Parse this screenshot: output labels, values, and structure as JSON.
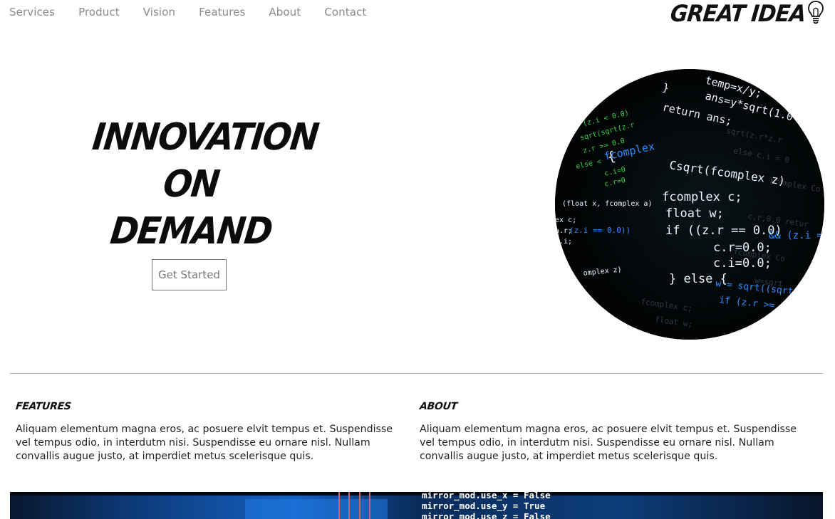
{
  "nav": {
    "items": [
      "Services",
      "Product",
      "Vision",
      "Features",
      "About",
      "Contact"
    ]
  },
  "logo": {
    "text": "GREAT IDEA",
    "icon": "lightbulb-icon"
  },
  "hero": {
    "title_lines": [
      "INNOVATION",
      "ON",
      "DEMAND"
    ],
    "cta_label": "Get Started",
    "image": "code-screen-image"
  },
  "sections": [
    {
      "heading": "FEATURES",
      "body": "Aliquam elementum magna eros, ac posuere elvit tempus et. Suspendisse vel tempus odio, in interdutm nisi. Suspendisse eu ornare nisl. Nullam convallis augue justo, at imperdiet metus scelerisque quis."
    },
    {
      "heading": "ABOUT",
      "body": "Aliquam elementum magna eros, ac posuere elvit tempus et. Suspendisse vel tempus odio, in interdutm nisi. Suspendisse eu ornare nisl. Nullam convallis augue justo, at imperdiet metus scelerisque quis."
    }
  ],
  "banner": {
    "code_lines": [
      "mirror_mod.use_x = False",
      "mirror_mod.use_y = True",
      "mirror_mod.use_z = False"
    ]
  },
  "colors": {
    "code_bg": "#020406",
    "code_white": "#e8f4ff",
    "code_green": "#3ddc4a",
    "code_blue": "#2a8fff",
    "banner_bg": "#0a1f3d"
  }
}
